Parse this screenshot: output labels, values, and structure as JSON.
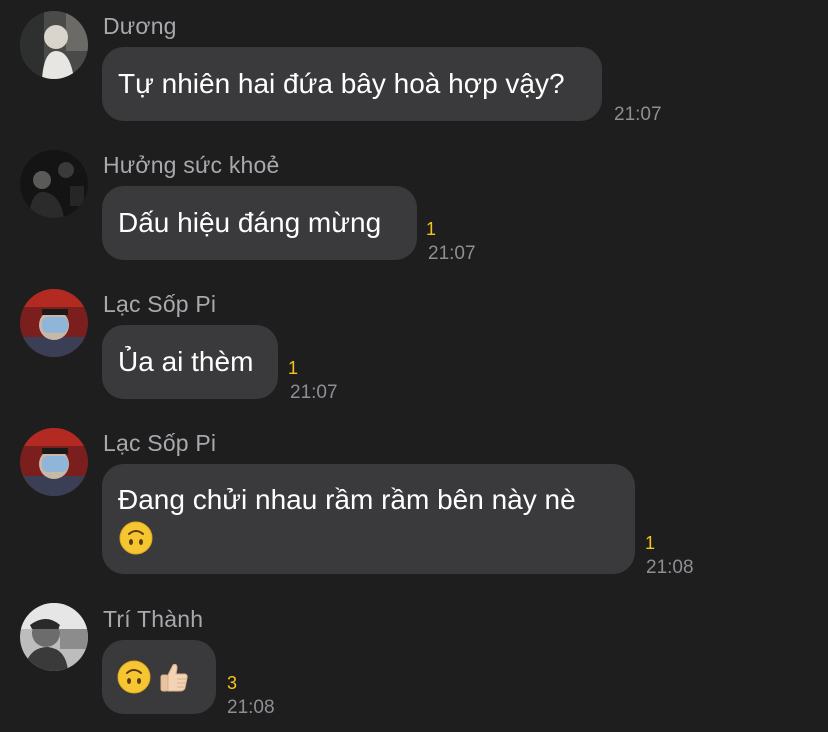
{
  "messages": [
    {
      "sender": "Dương",
      "text": "Tự nhiên hai đứa bây hoà hợp vậy?",
      "count": "",
      "time": "21:07"
    },
    {
      "sender": "Hưởng sức khoẻ",
      "text": "Dấu hiệu đáng mừng",
      "count": "1",
      "time": "21:07"
    },
    {
      "sender": "Lạc Sốp Pi",
      "text": "Ủa ai thèm",
      "count": "1",
      "time": "21:07"
    },
    {
      "sender": "Lạc Sốp Pi",
      "text": "Đang chửi nhau rầm rầm bên này nè",
      "emoji": "upside-down-face",
      "count": "1",
      "time": "21:08"
    },
    {
      "sender": "Trí Thành",
      "emojis": [
        "upside-down-face",
        "thumbs-up-light-skin"
      ],
      "count": "3",
      "time": "21:08"
    }
  ],
  "colors": {
    "background": "#1e1e1f",
    "bubble": "#3a3a3c",
    "sender_name": "#a8a8ad",
    "timestamp": "#8e8e93",
    "count": "#f5c518"
  }
}
